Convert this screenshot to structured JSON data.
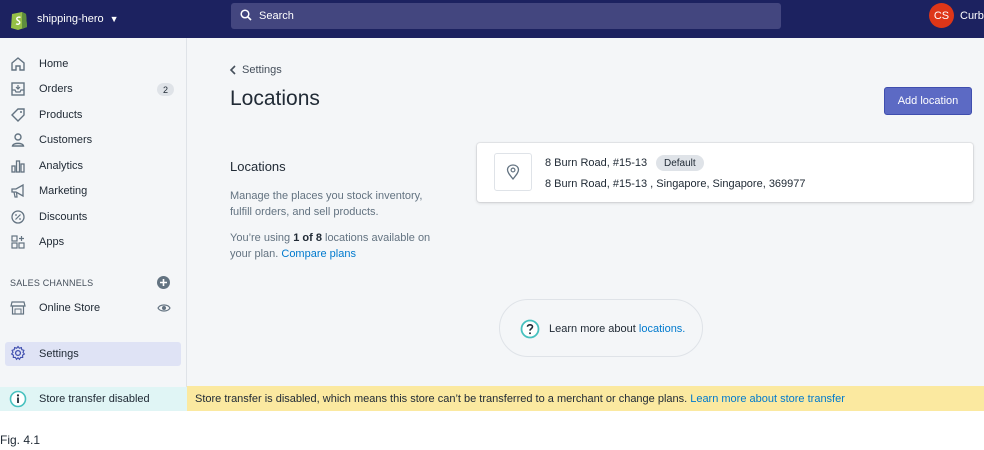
{
  "topbar": {
    "store_name": "shipping-hero",
    "search_placeholder": "Search",
    "avatar_initials": "CS",
    "user_name": "Curb"
  },
  "sidebar": {
    "items": [
      {
        "label": "Home",
        "icon": "home-icon"
      },
      {
        "label": "Orders",
        "icon": "orders-icon",
        "badge": "2"
      },
      {
        "label": "Products",
        "icon": "tag-icon"
      },
      {
        "label": "Customers",
        "icon": "person-icon"
      },
      {
        "label": "Analytics",
        "icon": "bar-chart-icon"
      },
      {
        "label": "Marketing",
        "icon": "megaphone-icon"
      },
      {
        "label": "Discounts",
        "icon": "discount-icon"
      },
      {
        "label": "Apps",
        "icon": "apps-icon"
      }
    ],
    "sales_channels_heading": "SALES CHANNELS",
    "online_store_label": "Online Store",
    "settings_label": "Settings",
    "store_transfer_label": "Store transfer disabled"
  },
  "main": {
    "breadcrumb": "Settings",
    "title": "Locations",
    "add_button": "Add location",
    "section_title": "Locations",
    "section_desc": "Manage the places you stock inventory, fulfill orders, and sell products.",
    "usage_prefix": "You’re using ",
    "usage_strong": "1 of 8",
    "usage_suffix": " locations available on your plan. ",
    "compare_link": "Compare plans",
    "location": {
      "name": "8 Burn Road, #15-13",
      "badge": "Default",
      "address": "8 Burn Road, #15-13 , Singapore, Singapore, 369977"
    },
    "learn_prefix": "Learn more about ",
    "learn_link": "locations."
  },
  "banner": {
    "text": "Store transfer is disabled, which means this store can’t be transferred to a merchant or change plans. ",
    "link": "Learn more about store transfer"
  },
  "caption": "Fig. 4.1",
  "colors": {
    "topbar": "#1c2260",
    "primary": "#5c6ac4",
    "link": "#007ace",
    "banner": "#fbe9a0",
    "teal": "#47c1bf",
    "avatar": "#de3618"
  }
}
